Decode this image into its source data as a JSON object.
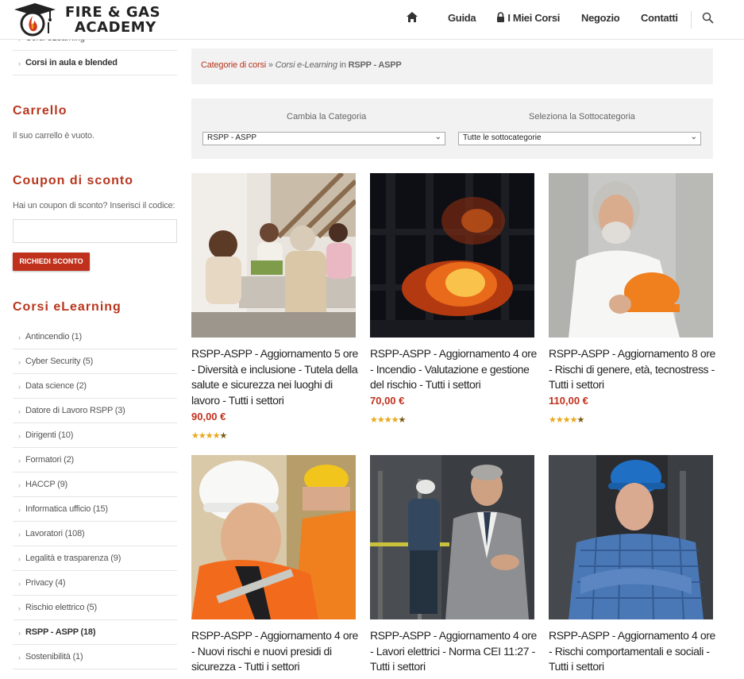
{
  "header": {
    "logo_line1": "FIRE & GAS",
    "logo_line2": "ACADEMY",
    "nav": [
      {
        "label": "",
        "icon": "home-icon"
      },
      {
        "label": "Guida"
      },
      {
        "label": "I Miei Corsi",
        "icon": "lock-icon"
      },
      {
        "label": "Negozio"
      },
      {
        "label": "Contatti"
      },
      {
        "label": "",
        "icon": "search-icon"
      }
    ]
  },
  "sidebar": {
    "top_items": [
      {
        "label": "Corsi eLearning"
      },
      {
        "label": "Corsi in aula e blended"
      }
    ],
    "cart": {
      "title": "Carrello",
      "text": "Il suo carrello è vuoto."
    },
    "coupon": {
      "title": "Coupon di sconto",
      "text": "Hai un coupon di sconto? Inserisci il codice:",
      "input_value": "",
      "button_label": "RICHIEDI SCONTO"
    },
    "elearning": {
      "title": "Corsi eLearning",
      "items": [
        {
          "label": "Antincendio (1)"
        },
        {
          "label": "Cyber Security (5)"
        },
        {
          "label": "Data science (2)"
        },
        {
          "label": "Datore di Lavoro RSPP (3)"
        },
        {
          "label": "Dirigenti (10)"
        },
        {
          "label": "Formatori (2)"
        },
        {
          "label": "HACCP (9)"
        },
        {
          "label": "Informatica ufficio (15)"
        },
        {
          "label": "Lavoratori (108)"
        },
        {
          "label": "Legalità e trasparenza (9)"
        },
        {
          "label": "Privacy (4)"
        },
        {
          "label": "Rischio elettrico (5)"
        },
        {
          "label": "RSPP - ASPP (18)",
          "active": true
        },
        {
          "label": "Sostenibilità (1)"
        }
      ]
    }
  },
  "breadcrumb": {
    "link": "Categorie di corsi",
    "sep": " » ",
    "current": "Corsi e-Learning",
    "in_text": " in ",
    "category": "RSPP - ASPP"
  },
  "filters": {
    "category_label": "Cambia la Categoria",
    "category_value": "RSPP - ASPP",
    "subcategory_label": "Seleziona la Sottocategoria",
    "subcategory_value": "Tutte le sottocategorie"
  },
  "products": [
    {
      "title": "RSPP-ASPP - Aggiornamento 5 ore - Diversità e inclusione - Tutela della salute e sicurezza nei luoghi di lavoro - Tutti i settori",
      "price": "90,00 €",
      "rating": 4.5,
      "stars": "★★★★★"
    },
    {
      "title": "RSPP-ASPP - Aggiornamento 4 ore - Incendio - Valutazione e gestione del rischio - Tutti i settori",
      "price": "70,00 €",
      "rating": 4.5,
      "stars": "★★★★★"
    },
    {
      "title": "RSPP-ASPP - Aggiornamento 8 ore - Rischi di genere, età, tecnostress - Tutti i settori",
      "price": "110,00 €",
      "rating": 4.5,
      "stars": "★★★★★"
    },
    {
      "title": "RSPP-ASPP - Aggiornamento 4 ore - Nuovi rischi e nuovi presidi di sicurezza - Tutti i settori",
      "price": "",
      "rating": null
    },
    {
      "title": "RSPP-ASPP - Aggiornamento 4 ore - Lavori elettrici - Norma CEI 11:27 - Tutti i settori",
      "price": "",
      "rating": null
    },
    {
      "title": "RSPP-ASPP - Aggiornamento 4 ore - Rischi comportamentali e sociali - Tutti i settori",
      "price": "",
      "rating": null
    }
  ],
  "colors": {
    "accent": "#b8361e",
    "button": "#c0311d",
    "star": "#e7a81a",
    "panel": "#f2f2f2"
  }
}
